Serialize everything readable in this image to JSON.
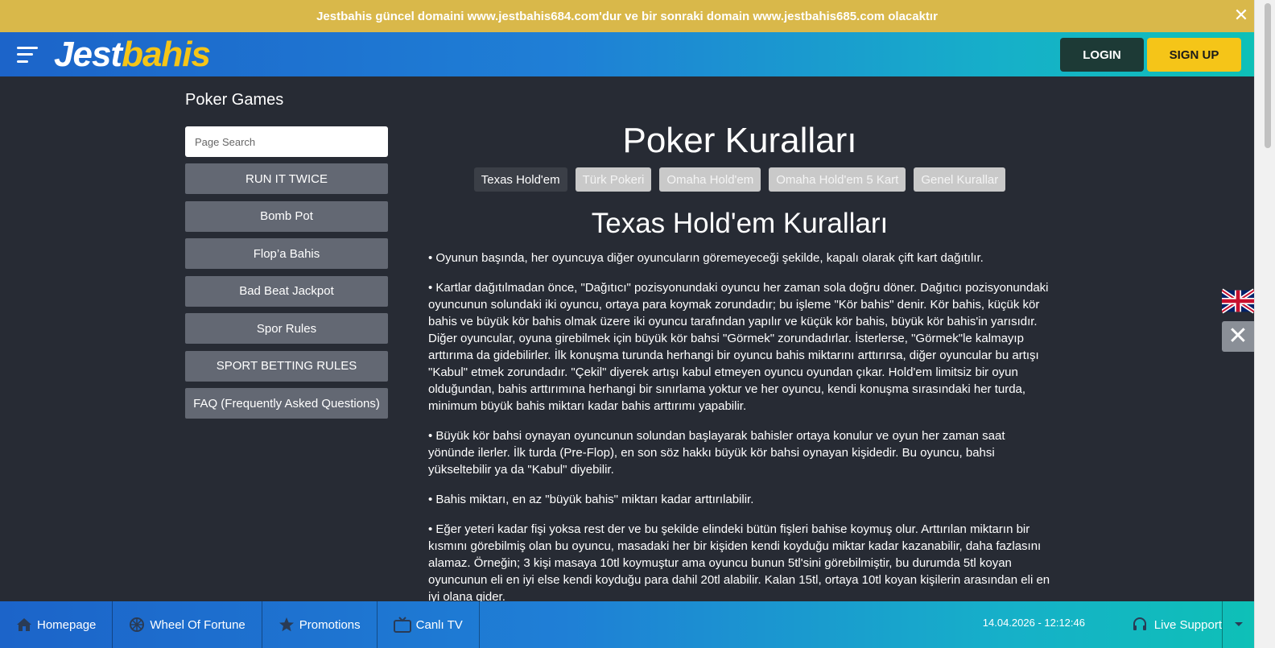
{
  "announcement": {
    "text": "Jestbahis güncel domaini www.jestbahis684.com'dur ve bir sonraki domain www.jestbahis685.com olacaktır"
  },
  "header": {
    "logo_part1": "Jest",
    "logo_part2": "bahis",
    "login_label": "LOGIN",
    "signup_label": "SIGN UP"
  },
  "sidebar": {
    "title": "Poker Games",
    "search_placeholder": "Page Search",
    "items": [
      {
        "label": "RUN IT TWICE"
      },
      {
        "label": "Bomb Pot"
      },
      {
        "label": "Flop’a Bahis"
      },
      {
        "label": "Bad Beat Jackpot"
      },
      {
        "label": "Spor Rules"
      },
      {
        "label": "SPORT BETTING RULES"
      },
      {
        "label": "FAQ (Frequently Asked Questions)"
      }
    ]
  },
  "main": {
    "title": "Poker Kuralları",
    "tabs": [
      {
        "label": "Texas Hold'em",
        "active": true
      },
      {
        "label": "Türk Pokeri",
        "active": false
      },
      {
        "label": "Omaha Hold'em",
        "active": false
      },
      {
        "label": "Omaha Hold'em 5 Kart",
        "active": false
      },
      {
        "label": "Genel Kurallar",
        "active": false
      }
    ],
    "section_title": "Texas Hold'em Kuralları",
    "paragraphs": [
      "• Oyunun başında, her oyuncuya diğer oyuncuların göremeyeceği şekilde, kapalı olarak çift kart dağıtılır.",
      "• Kartlar dağıtılmadan önce, \"Dağıtıcı\" pozisyonundaki oyuncu her zaman sola doğru döner. Dağıtıcı pozisyonundaki oyuncunun solundaki iki oyuncu, ortaya para koymak zorundadır; bu işleme \"Kör bahis\" denir. Kör bahis, küçük kör bahis ve büyük kör bahis olmak üzere iki oyuncu tarafından yapılır ve küçük kör bahis, büyük kör bahis'in yarısıdır. Diğer oyuncular, oyuna girebilmek için büyük kör bahsi \"Görmek\" zorundadırlar. İsterlerse, \"Görmek\"le kalmayıp arttırıma da gidebilirler. İlk konuşma turunda herhangi bir oyuncu bahis miktarını arttırırsa, diğer oyuncular bu artışı \"Kabul\" etmek zorundadır. \"Çekil\" diyerek artışı kabul etmeyen oyuncu oyundan çıkar. Hold'em limitsiz bir oyun olduğundan, bahis arttırımına herhangi bir sınırlama yoktur ve her oyuncu, kendi konuşma sırasındaki her turda, minimum büyük bahis miktarı kadar bahis arttırımı yapabilir.",
      "• Büyük kör bahsi oynayan oyuncunun solundan başlayarak bahisler ortaya konulur ve oyun her zaman saat yönünde ilerler. İlk turda (Pre-Flop), en son söz hakkı büyük kör bahsi oynayan kişidedir. Bu oyuncu, bahsi yükseltebilir ya da \"Kabul\" diyebilir.",
      "• Bahis miktarı, en az \"büyük bahis\" miktarı kadar arttırılabilir.",
      "• Eğer yeteri kadar fişi yoksa rest der ve bu şekilde elindeki bütün fişleri bahise koymuş olur. Arttırılan miktarın bir kısmını görebilmiş olan bu oyuncu, masadaki her bir kişiden kendi koyduğu miktar kadar kazanabilir, daha fazlasını alamaz. Örneğin; 3 kişi masaya 10tl koymuştur ama oyuncu bunun 5tl'sini görebilmiştir, bu durumda 5tl koyan oyuncunun eli en iyi else kendi koyduğu para dahil 20tl alabilir. Kalan 15tl, ortaya 10tl koyan kişilerin arasından eli en iyi olana gider."
    ]
  },
  "bottom": {
    "items": [
      {
        "label": "Homepage",
        "icon": "home-icon"
      },
      {
        "label": "Wheel Of Fortune",
        "icon": "wheel-icon"
      },
      {
        "label": "Promotions",
        "icon": "star-icon"
      },
      {
        "label": "Canlı TV",
        "icon": "tv-icon"
      }
    ],
    "datetime": "14.04.2026 - 12:12:46",
    "support_label": "Live Support"
  },
  "colors": {
    "announcement": "#d9b84a",
    "accent_yellow": "#f5c518",
    "background": "#272b34",
    "sidebar_button": "#636873"
  }
}
